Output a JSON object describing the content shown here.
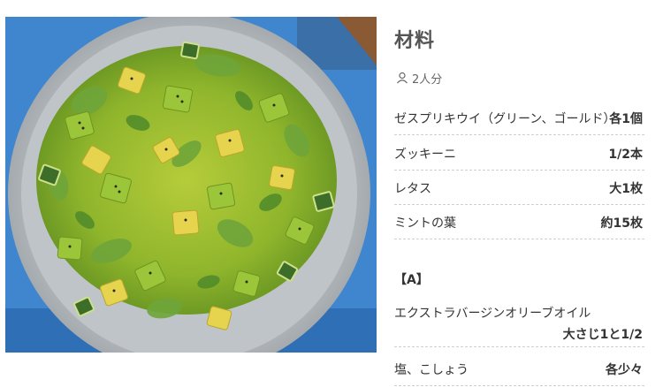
{
  "recipe": {
    "photo_alt": "",
    "title": "材料",
    "servings": "2人分",
    "ingredients": [
      {
        "name": "ゼスプリキウイ（グリーン、ゴールド）",
        "amount": "各1個"
      },
      {
        "name": "ズッキーニ",
        "amount": "1/2本"
      },
      {
        "name": "レタス",
        "amount": "大1枚"
      },
      {
        "name": "ミントの葉",
        "amount": "約15枚"
      }
    ],
    "group_a": {
      "label": "【A】",
      "ingredients": [
        {
          "name": "エクストラバージンオリーブオイル",
          "amount": "大さじ1と1/2"
        },
        {
          "name": "塩、こしょう",
          "amount": "各少々"
        }
      ]
    }
  },
  "colors": {
    "tablecloth": "#3a7fc9",
    "plate": "#b9bec2",
    "kiwi_green": "#8dbb2c",
    "kiwi_gold": "#e8d44d",
    "dashed_line": "#cfcfcf"
  }
}
